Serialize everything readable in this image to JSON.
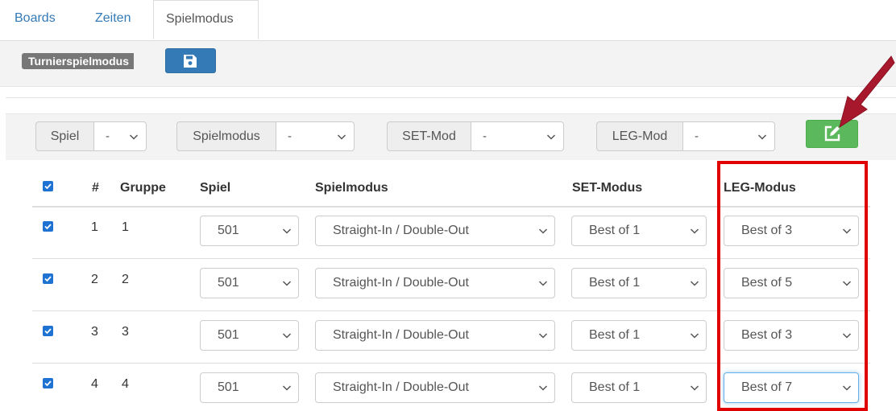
{
  "tabs": [
    {
      "label": "Boards",
      "active": false
    },
    {
      "label": "Zeiten",
      "active": false
    },
    {
      "label": "Spielmodus",
      "active": true
    }
  ],
  "section": {
    "badge_label": "Turnierspielmodus",
    "save_icon": "floppy-disk-icon"
  },
  "filters": {
    "spiel": {
      "label": "Spiel",
      "value": "-"
    },
    "spielmodus": {
      "label": "Spielmodus",
      "value": "-"
    },
    "set_mod": {
      "label": "SET-Mod",
      "value": "-"
    },
    "leg_mod": {
      "label": "LEG-Mod",
      "value": "-"
    },
    "edit_icon": "edit-icon"
  },
  "table": {
    "headers": {
      "number": "#",
      "gruppe": "Gruppe",
      "spiel": "Spiel",
      "spielmodus": "Spielmodus",
      "set_modus": "SET-Modus",
      "leg_modus": "LEG-Modus"
    },
    "rows": [
      {
        "checked": true,
        "number": "1",
        "gruppe": "1",
        "spiel": "501",
        "spielmodus": "Straight-In / Double-Out",
        "set_modus": "Best of 1",
        "leg_modus": "Best of 3"
      },
      {
        "checked": true,
        "number": "2",
        "gruppe": "2",
        "spiel": "501",
        "spielmodus": "Straight-In / Double-Out",
        "set_modus": "Best of 1",
        "leg_modus": "Best of 5"
      },
      {
        "checked": true,
        "number": "3",
        "gruppe": "3",
        "spiel": "501",
        "spielmodus": "Straight-In / Double-Out",
        "set_modus": "Best of 1",
        "leg_modus": "Best of 3"
      },
      {
        "checked": true,
        "number": "4",
        "gruppe": "4",
        "spiel": "501",
        "spielmodus": "Straight-In / Double-Out",
        "set_modus": "Best of 1",
        "leg_modus": "Best of 7"
      }
    ]
  },
  "colors": {
    "link": "#337ab7",
    "primary": "#337ab7",
    "success": "#5cb85c",
    "highlight": "#e00000",
    "arrow": "#a8182c",
    "checkbox": "#1e73d2"
  }
}
